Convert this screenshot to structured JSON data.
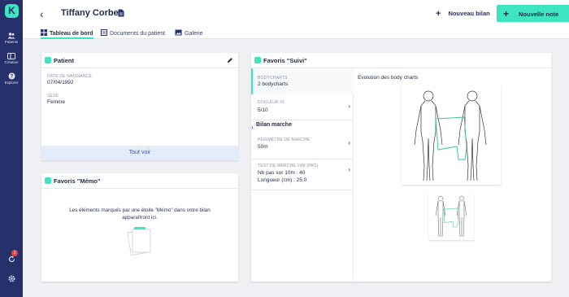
{
  "app": {
    "logo_letter": "K"
  },
  "sidebar": {
    "items": [
      {
        "label": "Patients",
        "icon": "users-icon"
      },
      {
        "label": "Création",
        "icon": "layout-icon"
      },
      {
        "label": "Explorer",
        "icon": "help-icon"
      }
    ],
    "notification_count": "1"
  },
  "header": {
    "patient_name": "Tiffany Corbet",
    "nouveau_bilan": "Nouveau bilan",
    "nouvelle_note": "Nouvelle note"
  },
  "tabs": [
    {
      "label": "Tableau de bord",
      "active": true
    },
    {
      "label": "Documents du patient",
      "active": false
    },
    {
      "label": "Galerie",
      "active": false
    }
  ],
  "patient_card": {
    "title": "Patient",
    "dob_label": "DATE DE NAISSANCE",
    "dob_value": "07/04/1992",
    "sex_label": "SEXE",
    "sex_value": "Femme",
    "see_all": "Tout voir"
  },
  "memo_card": {
    "title": "Favoris \"Mémo\"",
    "empty_text": "Les éléments marqués par une étoile \"Mémo\" dans votre bilan apparaîtront ici."
  },
  "suivi_card": {
    "title": "Favoris \"Suivi\"",
    "bodycharts_label": "BODYCHARTS",
    "bodycharts_value": "2 bodycharts",
    "douleur_label": "DOULEUR #1",
    "douleur_value": "5/10",
    "section_title": "Bilan marche",
    "perimetre_label": "PÉRIMÈTRE DE MARCHE",
    "perimetre_value": "50m",
    "test_label": "TEST DE MARCHE 10M (PAS)",
    "test_value_1": "Nb pas sur 10m : 40",
    "test_value_2": "Longueur (cm) : 25.0",
    "chart_title": "Evolution des body charts"
  },
  "colors": {
    "accent": "#3ee6c0",
    "sidebar": "#26306b",
    "background": "#eef0f4"
  }
}
